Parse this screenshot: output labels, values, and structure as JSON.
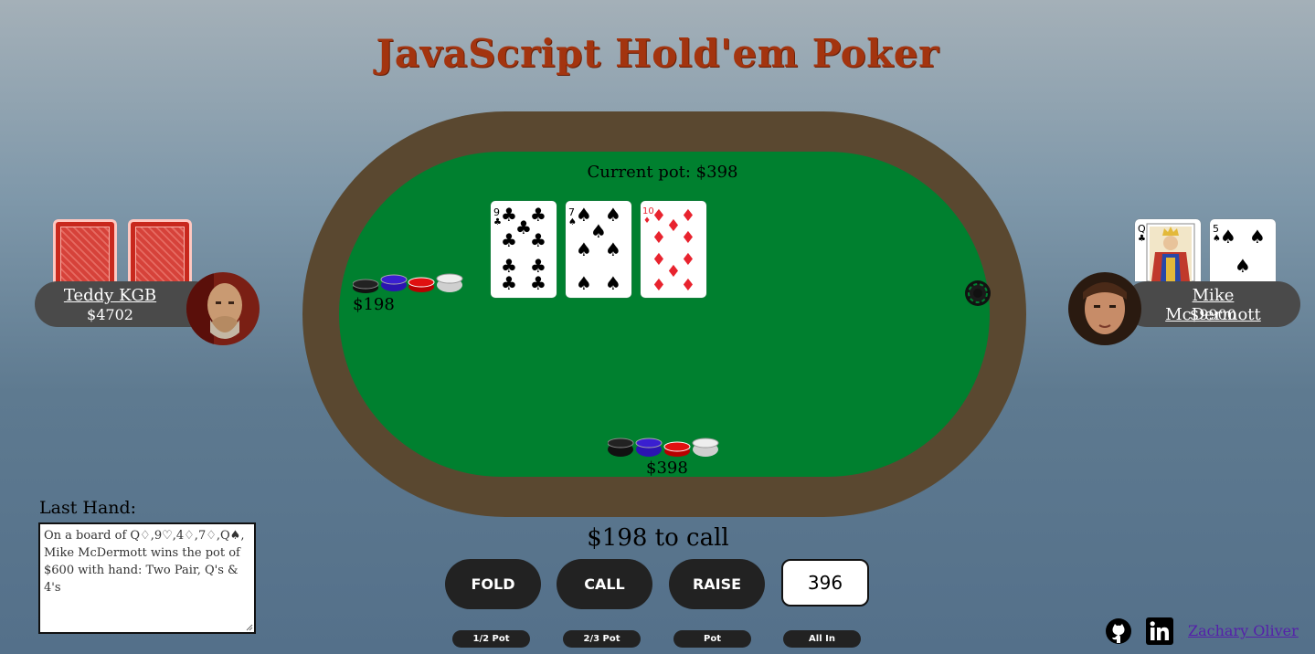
{
  "title": "JavaScript Hold'em Poker",
  "pot": {
    "label": "Current pot: $398"
  },
  "board": [
    {
      "rank": "9",
      "suit": "clubs",
      "symbol": "♣",
      "color": "#000000"
    },
    {
      "rank": "7",
      "suit": "spades",
      "symbol": "♠",
      "color": "#000000"
    },
    {
      "rank": "10",
      "suit": "diamonds",
      "symbol": "♦",
      "color": "#e8232e"
    }
  ],
  "players": {
    "left": {
      "name": "Teddy KGB",
      "stack": "$4702",
      "bet": "$198",
      "cards": "face-down"
    },
    "right": {
      "name": "Mike McDermott",
      "stack": "$9900",
      "cards": [
        {
          "rank": "Q",
          "suit": "clubs",
          "symbol": "♣",
          "color": "#000000"
        },
        {
          "rank": "5",
          "suit": "spades",
          "symbol": "♠",
          "color": "#000000"
        }
      ]
    }
  },
  "center_bet": "$398",
  "to_call": "$198 to call",
  "actions": {
    "fold": "FOLD",
    "call": "CALL",
    "raise": "RAISE",
    "raise_value": "396"
  },
  "bet_sizes": {
    "half": "1/2 Pot",
    "two_thirds": "2/3 Pot",
    "pot": "Pot",
    "all_in": "All In"
  },
  "last_hand": {
    "label": "Last Hand:",
    "text": "On a board of Q♢,9♡,4♢,7♢,Q♠, Mike McDermott wins the pot of $600 with hand: Two Pair, Q's & 4's"
  },
  "footer": {
    "author": "Zachary Oliver",
    "icons": [
      "github-icon",
      "linkedin-icon"
    ]
  },
  "colors": {
    "felt": "#00802f",
    "rail": "#5a4830",
    "title": "#a3340f",
    "chip_black": "#111111",
    "chip_blue": "#3a1fd0",
    "chip_red": "#e01010",
    "chip_white": "#eeeeee"
  }
}
